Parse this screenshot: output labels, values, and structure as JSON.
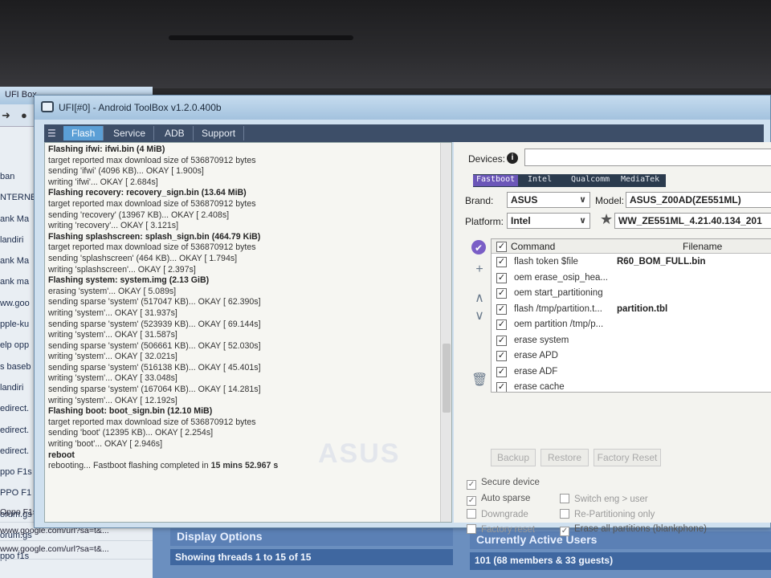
{
  "window": {
    "title": "UFI[#0] - Android ToolBox v1.2.0.400b"
  },
  "tabs": [
    "Flash",
    "Service",
    "ADB",
    "Support"
  ],
  "log": [
    {
      "text": "Flashing ifwi: ifwi.bin (4 MiB)",
      "bold": true
    },
    {
      "text": "target reported max download size of 536870912 bytes"
    },
    {
      "text": "sending 'ifwi' (4096 KB)... OKAY [  1.900s]"
    },
    {
      "text": "writing 'ifwi'... OKAY [  2.684s]"
    },
    {
      "text": "Flashing recovery: recovery_sign.bin (13.64 MiB)",
      "bold": true
    },
    {
      "text": "target reported max download size of 536870912 bytes"
    },
    {
      "text": "sending 'recovery' (13967 KB)... OKAY [  2.408s]"
    },
    {
      "text": "writing 'recovery'... OKAY [  3.121s]"
    },
    {
      "text": "Flashing splashscreen: splash_sign.bin (464.79 KiB)",
      "bold": true
    },
    {
      "text": "target reported max download size of 536870912 bytes"
    },
    {
      "text": "sending 'splashscreen' (464 KB)... OKAY [  1.794s]"
    },
    {
      "text": "writing 'splashscreen'... OKAY [  2.397s]"
    },
    {
      "text": "Flashing system: system.img (2.13 GiB)",
      "bold": true
    },
    {
      "text": "erasing 'system'... OKAY [  5.089s]"
    },
    {
      "text": "sending sparse 'system' (517047 KB)... OKAY [ 62.390s]"
    },
    {
      "text": "writing 'system'... OKAY [ 31.937s]"
    },
    {
      "text": "sending sparse 'system' (523939 KB)... OKAY [ 69.144s]"
    },
    {
      "text": "writing 'system'... OKAY [ 31.587s]"
    },
    {
      "text": "sending sparse 'system' (506661 KB)... OKAY [ 52.030s]"
    },
    {
      "text": "writing 'system'... OKAY [ 32.021s]"
    },
    {
      "text": "sending sparse 'system' (516138 KB)... OKAY [ 45.401s]"
    },
    {
      "text": "writing 'system'... OKAY [ 33.048s]"
    },
    {
      "text": "sending sparse 'system' (167064 KB)... OKAY [ 14.281s]"
    },
    {
      "text": "writing 'system'... OKAY [ 12.192s]"
    },
    {
      "text": "Flashing boot: boot_sign.bin (12.10 MiB)",
      "bold": true
    },
    {
      "text": "target reported max download size of 536870912 bytes"
    },
    {
      "text": "sending 'boot' (12395 KB)... OKAY [  2.254s]"
    },
    {
      "text": "writing 'boot'... OKAY [  2.946s]"
    },
    {
      "text": "reboot",
      "bold": true
    },
    {
      "text": "rebooting... Fastboot flashing completed in ",
      "suffix": "15 mins 52.967 s"
    }
  ],
  "watermark": "ASUS",
  "devices": {
    "label": "Devices:",
    "value": ""
  },
  "platform_tabs": [
    "Fastboot",
    "Intel",
    "Qualcomm",
    "MediaTek"
  ],
  "brand": {
    "label": "Brand:",
    "value": "ASUS"
  },
  "model": {
    "label": "Model:",
    "value": "ASUS_Z00AD(ZE551ML)"
  },
  "platform": {
    "label": "Platform:",
    "value": "Intel"
  },
  "firmware": {
    "value": "WW_ZE551ML_4.21.40.134_201"
  },
  "table": {
    "col_command": "Command",
    "col_filename": "Filename",
    "rows": [
      {
        "command": "flash token $file",
        "filename": "R60_BOM_FULL.bin"
      },
      {
        "command": "oem erase_osip_hea...",
        "filename": ""
      },
      {
        "command": "oem start_partitioning",
        "filename": ""
      },
      {
        "command": "flash /tmp/partition.t...",
        "filename": "partition.tbl"
      },
      {
        "command": "oem partition /tmp/p...",
        "filename": ""
      },
      {
        "command": "erase system",
        "filename": ""
      },
      {
        "command": "erase APD",
        "filename": ""
      },
      {
        "command": "erase ADF",
        "filename": ""
      },
      {
        "command": "erase cache",
        "filename": ""
      }
    ]
  },
  "buttons": {
    "backup": "Backup",
    "restore": "Restore",
    "factory_reset": "Factory Reset"
  },
  "options": {
    "secure_device": {
      "label": "Secure device",
      "checked": true
    },
    "auto_sparse": {
      "label": "Auto sparse",
      "checked": true
    },
    "downgrade": {
      "label": "Downgrade",
      "checked": false
    },
    "factory_reset": {
      "label": "Factory reset",
      "checked": false
    },
    "switch_eng": {
      "label": "Switch eng > user",
      "checked": false
    },
    "re_partitioning": {
      "label": "Re-Partitioning only",
      "checked": false
    },
    "erase_all": {
      "label": "Erase all partitions (blankphone)",
      "checked": true
    }
  },
  "background": {
    "browser_title": "UFI Box",
    "left_items": [
      "ban",
      "NTERNE",
      "ank Ma",
      "landiri",
      "ank Ma",
      "ank ma",
      "ww.goo",
      "pple-ku",
      "elp opp",
      "s baseb",
      "landiri",
      "edirect.",
      "edirect.",
      "edirect.",
      "ppo F1s",
      "PPO F1",
      "orum.gs",
      "orum.gs",
      "ppo f1s"
    ],
    "urls": [
      "Oppo F1s Baseband unknow...",
      "www.google.com/url?sa=t&...",
      "www.google.com/url?sa=t&..."
    ],
    "forum": {
      "display_options": "Display Options",
      "showing_threads": "Showing threads 1 to 15 of 15",
      "active_users": "Currently Active Users",
      "active_count": "101 (68 members & 33 guests)"
    }
  }
}
